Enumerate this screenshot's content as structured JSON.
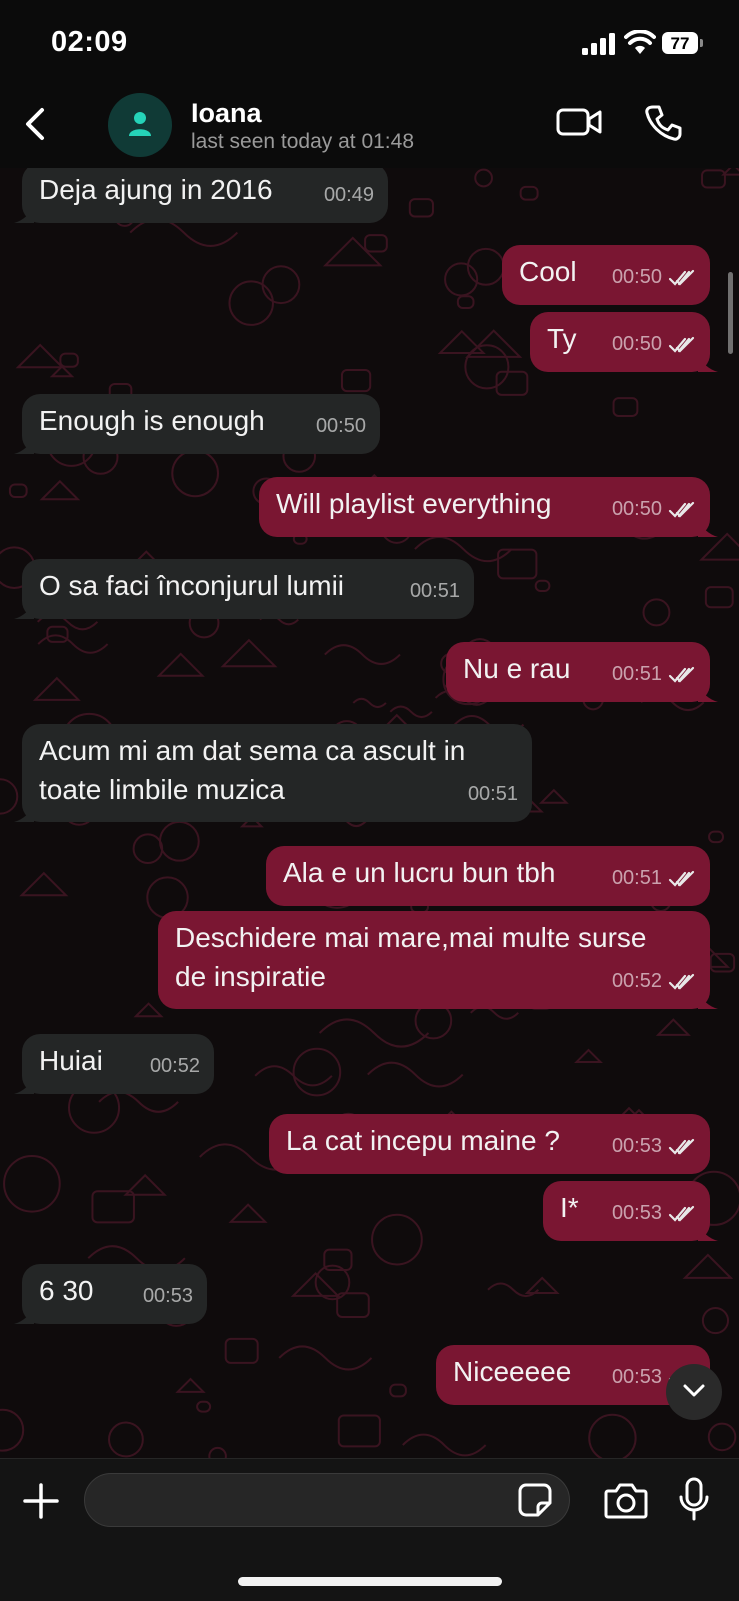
{
  "status_bar": {
    "time": "02:09",
    "battery": "77"
  },
  "header": {
    "contact_name": "Ioana",
    "last_seen": "last seen today at 01:48"
  },
  "colors": {
    "outgoing_bubble": "#7a1632",
    "incoming_bubble": "#242626",
    "avatar_bg": "#103a36",
    "avatar_icon": "#25d3b8"
  },
  "messages": [
    {
      "dir": "in",
      "lines": [
        "Deja ajung in 2016"
      ],
      "time": "00:49"
    },
    {
      "dir": "out",
      "lines": [
        "Cool"
      ],
      "time": "00:50",
      "status": "read"
    },
    {
      "dir": "out",
      "lines": [
        "Ty"
      ],
      "time": "00:50",
      "status": "read"
    },
    {
      "dir": "in",
      "lines": [
        "Enough is enough"
      ],
      "time": "00:50"
    },
    {
      "dir": "out",
      "lines": [
        "Will playlist everything"
      ],
      "time": "00:50",
      "status": "read"
    },
    {
      "dir": "in",
      "lines": [
        "O sa faci înconjurul lumii"
      ],
      "time": "00:51"
    },
    {
      "dir": "out",
      "lines": [
        "Nu e rau"
      ],
      "time": "00:51",
      "status": "read"
    },
    {
      "dir": "in",
      "lines": [
        "Acum mi am dat sema ca ascult in",
        "toate limbile muzica"
      ],
      "time": "00:51"
    },
    {
      "dir": "out",
      "lines": [
        "Ala e un lucru bun tbh"
      ],
      "time": "00:51",
      "status": "read"
    },
    {
      "dir": "out",
      "lines": [
        "Deschidere mai mare,mai multe surse",
        "de inspiratie"
      ],
      "time": "00:52",
      "status": "read"
    },
    {
      "dir": "in",
      "lines": [
        "Huiai"
      ],
      "time": "00:52"
    },
    {
      "dir": "out",
      "lines": [
        "La cat incepu maine ?"
      ],
      "time": "00:53",
      "status": "read"
    },
    {
      "dir": "out",
      "lines": [
        "I*"
      ],
      "time": "00:53",
      "status": "read"
    },
    {
      "dir": "in",
      "lines": [
        "6 30"
      ],
      "time": "00:53"
    },
    {
      "dir": "out",
      "lines": [
        "Niceeeee"
      ],
      "time": "00:53",
      "status": "read"
    }
  ],
  "composer": {
    "value": "",
    "placeholder": ""
  },
  "icons": {
    "back": "chevron-left-icon",
    "video": "video-camera-icon",
    "call": "phone-icon",
    "add": "plus-icon",
    "sticker": "sticker-icon",
    "camera": "camera-icon",
    "mic": "microphone-icon",
    "scroll_down": "chevron-down-icon"
  }
}
